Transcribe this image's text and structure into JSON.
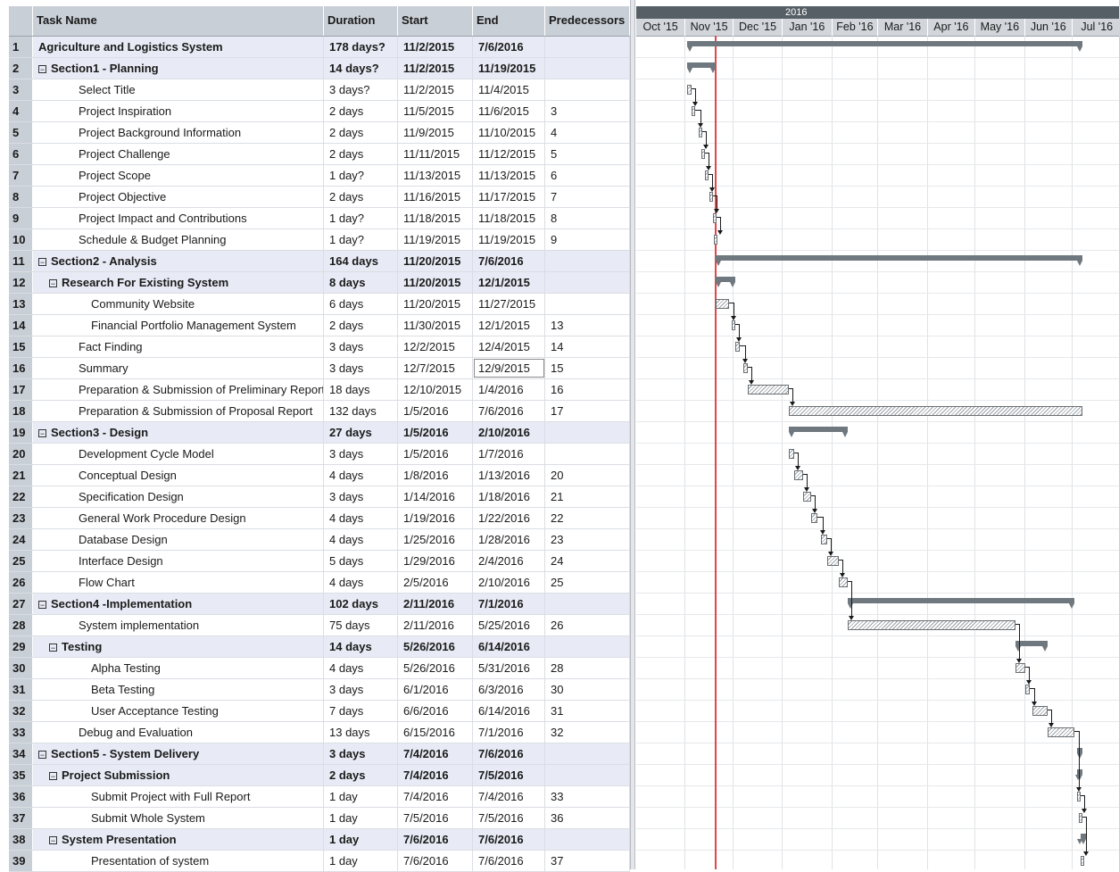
{
  "table": {
    "headers": {
      "num": "",
      "name": "Task Name",
      "duration": "Duration",
      "start": "Start",
      "end": "End",
      "predecessors": "Predecessors"
    },
    "rows": [
      {
        "id": "1",
        "name": "Agriculture and Logistics System",
        "duration": "178 days?",
        "start": "11/2/2015",
        "end": "7/6/2016",
        "pred": "",
        "summary": true,
        "collapse": false,
        "indent": 0
      },
      {
        "id": "2",
        "name": "Section1 - Planning",
        "duration": "14 days?",
        "start": "11/2/2015",
        "end": "11/19/2015",
        "pred": "",
        "summary": true,
        "collapse": true,
        "indent": 0
      },
      {
        "id": "3",
        "name": "Select Title",
        "duration": "3 days?",
        "start": "11/2/2015",
        "end": "11/4/2015",
        "pred": "",
        "summary": false,
        "indent": 2
      },
      {
        "id": "4",
        "name": "Project Inspiration",
        "duration": "2 days",
        "start": "11/5/2015",
        "end": "11/6/2015",
        "pred": "3",
        "summary": false,
        "indent": 2
      },
      {
        "id": "5",
        "name": "Project Background Information",
        "duration": "2 days",
        "start": "11/9/2015",
        "end": "11/10/2015",
        "pred": "4",
        "summary": false,
        "indent": 2
      },
      {
        "id": "6",
        "name": "Project Challenge",
        "duration": "2 days",
        "start": "11/11/2015",
        "end": "11/12/2015",
        "pred": "5",
        "summary": false,
        "indent": 2
      },
      {
        "id": "7",
        "name": "Project Scope",
        "duration": "1 day?",
        "start": "11/13/2015",
        "end": "11/13/2015",
        "pred": "6",
        "summary": false,
        "indent": 2
      },
      {
        "id": "8",
        "name": "Project Objective",
        "duration": "2 days",
        "start": "11/16/2015",
        "end": "11/17/2015",
        "pred": "7",
        "summary": false,
        "indent": 2
      },
      {
        "id": "9",
        "name": "Project Impact and Contributions",
        "duration": "1 day?",
        "start": "11/18/2015",
        "end": "11/18/2015",
        "pred": "8",
        "summary": false,
        "indent": 2
      },
      {
        "id": "10",
        "name": "Schedule & Budget Planning",
        "duration": "1 day?",
        "start": "11/19/2015",
        "end": "11/19/2015",
        "pred": "9",
        "summary": false,
        "indent": 2
      },
      {
        "id": "11",
        "name": "Section2 - Analysis",
        "duration": "164 days",
        "start": "11/20/2015",
        "end": "7/6/2016",
        "pred": "",
        "summary": true,
        "collapse": true,
        "indent": 0
      },
      {
        "id": "12",
        "name": "Research For Existing System",
        "duration": "8 days",
        "start": "11/20/2015",
        "end": "12/1/2015",
        "pred": "",
        "summary": true,
        "collapse": true,
        "indent": 1
      },
      {
        "id": "13",
        "name": "Community Website",
        "duration": "6 days",
        "start": "11/20/2015",
        "end": "11/27/2015",
        "pred": "",
        "summary": false,
        "indent": 3
      },
      {
        "id": "14",
        "name": "Financial Portfolio Management System",
        "duration": "2 days",
        "start": "11/30/2015",
        "end": "12/1/2015",
        "pred": "13",
        "summary": false,
        "indent": 3
      },
      {
        "id": "15",
        "name": "Fact Finding",
        "duration": "3 days",
        "start": "12/2/2015",
        "end": "12/4/2015",
        "pred": "14",
        "summary": false,
        "indent": 2
      },
      {
        "id": "16",
        "name": "Summary",
        "duration": "3 days",
        "start": "12/7/2015",
        "end": "12/9/2015",
        "pred": "15",
        "summary": false,
        "indent": 2,
        "selected": true
      },
      {
        "id": "17",
        "name": "Preparation & Submission of Preliminary Report",
        "duration": "18 days",
        "start": "12/10/2015",
        "end": "1/4/2016",
        "pred": "16",
        "summary": false,
        "indent": 2
      },
      {
        "id": "18",
        "name": "Preparation & Submission of Proposal Report",
        "duration": "132 days",
        "start": "1/5/2016",
        "end": "7/6/2016",
        "pred": "17",
        "summary": false,
        "indent": 2
      },
      {
        "id": "19",
        "name": "Section3 - Design",
        "duration": "27 days",
        "start": "1/5/2016",
        "end": "2/10/2016",
        "pred": "",
        "summary": true,
        "collapse": true,
        "indent": 0
      },
      {
        "id": "20",
        "name": "Development Cycle Model",
        "duration": "3 days",
        "start": "1/5/2016",
        "end": "1/7/2016",
        "pred": "",
        "summary": false,
        "indent": 2
      },
      {
        "id": "21",
        "name": "Conceptual Design",
        "duration": "4 days",
        "start": "1/8/2016",
        "end": "1/13/2016",
        "pred": "20",
        "summary": false,
        "indent": 2
      },
      {
        "id": "22",
        "name": "Specification Design",
        "duration": "3 days",
        "start": "1/14/2016",
        "end": "1/18/2016",
        "pred": "21",
        "summary": false,
        "indent": 2
      },
      {
        "id": "23",
        "name": "General Work Procedure Design",
        "duration": "4 days",
        "start": "1/19/2016",
        "end": "1/22/2016",
        "pred": "22",
        "summary": false,
        "indent": 2
      },
      {
        "id": "24",
        "name": "Database Design",
        "duration": "4 days",
        "start": "1/25/2016",
        "end": "1/28/2016",
        "pred": "23",
        "summary": false,
        "indent": 2
      },
      {
        "id": "25",
        "name": "Interface Design",
        "duration": "5 days",
        "start": "1/29/2016",
        "end": "2/4/2016",
        "pred": "24",
        "summary": false,
        "indent": 2
      },
      {
        "id": "26",
        "name": "Flow Chart",
        "duration": "4 days",
        "start": "2/5/2016",
        "end": "2/10/2016",
        "pred": "25",
        "summary": false,
        "indent": 2
      },
      {
        "id": "27",
        "name": "Section4 -Implementation",
        "duration": "102 days",
        "start": "2/11/2016",
        "end": "7/1/2016",
        "pred": "",
        "summary": true,
        "collapse": true,
        "indent": 0
      },
      {
        "id": "28",
        "name": "System implementation",
        "duration": "75 days",
        "start": "2/11/2016",
        "end": "5/25/2016",
        "pred": "26",
        "summary": false,
        "indent": 2
      },
      {
        "id": "29",
        "name": "Testing",
        "duration": "14 days",
        "start": "5/26/2016",
        "end": "6/14/2016",
        "pred": "",
        "summary": true,
        "collapse": true,
        "indent": 1
      },
      {
        "id": "30",
        "name": "Alpha Testing",
        "duration": "4 days",
        "start": "5/26/2016",
        "end": "5/31/2016",
        "pred": "28",
        "summary": false,
        "indent": 3
      },
      {
        "id": "31",
        "name": "Beta Testing",
        "duration": "3 days",
        "start": "6/1/2016",
        "end": "6/3/2016",
        "pred": "30",
        "summary": false,
        "indent": 3
      },
      {
        "id": "32",
        "name": "User Acceptance Testing",
        "duration": "7 days",
        "start": "6/6/2016",
        "end": "6/14/2016",
        "pred": "31",
        "summary": false,
        "indent": 3
      },
      {
        "id": "33",
        "name": "Debug and Evaluation",
        "duration": "13 days",
        "start": "6/15/2016",
        "end": "7/1/2016",
        "pred": "32",
        "summary": false,
        "indent": 2
      },
      {
        "id": "34",
        "name": "Section5 - System Delivery",
        "duration": "3 days",
        "start": "7/4/2016",
        "end": "7/6/2016",
        "pred": "",
        "summary": true,
        "collapse": true,
        "indent": 0
      },
      {
        "id": "35",
        "name": "Project Submission",
        "duration": "2 days",
        "start": "7/4/2016",
        "end": "7/5/2016",
        "pred": "",
        "summary": true,
        "collapse": true,
        "indent": 1
      },
      {
        "id": "36",
        "name": "Submit Project with Full Report",
        "duration": "1 day",
        "start": "7/4/2016",
        "end": "7/4/2016",
        "pred": "33",
        "summary": false,
        "indent": 3
      },
      {
        "id": "37",
        "name": "Submit Whole System",
        "duration": "1 day",
        "start": "7/5/2016",
        "end": "7/5/2016",
        "pred": "36",
        "summary": false,
        "indent": 3
      },
      {
        "id": "38",
        "name": "System Presentation",
        "duration": "1 day",
        "start": "7/6/2016",
        "end": "7/6/2016",
        "pred": "",
        "summary": true,
        "collapse": true,
        "indent": 1
      },
      {
        "id": "39",
        "name": "Presentation of system",
        "duration": "1 day",
        "start": "7/6/2016",
        "end": "7/6/2016",
        "pred": "37",
        "summary": false,
        "indent": 3
      }
    ]
  },
  "timeline": {
    "year_label": "2016",
    "months": [
      "Oct '15",
      "Nov '15",
      "Dec '15",
      "Jan '16",
      "Feb '16",
      "Mar '16",
      "Apr '16",
      "May '16",
      "Jun '16",
      "Jul '16"
    ],
    "today_date": "11/20/2015"
  },
  "colors": {
    "summary_bar": "#6f787e",
    "today_line": "#e0474c",
    "header_bg": "#c9cfd6",
    "summary_row_bg": "#e8ebf5"
  }
}
